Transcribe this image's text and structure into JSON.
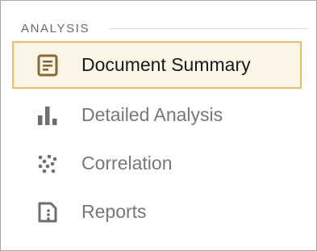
{
  "section": {
    "title": "ANALYSIS"
  },
  "nav": {
    "items": [
      {
        "label": "Document Summary",
        "icon": "document-summary-icon",
        "active": true
      },
      {
        "label": "Detailed Analysis",
        "icon": "bar-chart-icon",
        "active": false
      },
      {
        "label": "Correlation",
        "icon": "scatter-dots-icon",
        "active": false
      },
      {
        "label": "Reports",
        "icon": "report-page-icon",
        "active": false
      }
    ]
  },
  "colors": {
    "active_border": "#e8c062",
    "active_background": "#fbf5e8",
    "active_icon": "#8a6a34",
    "inactive_icon": "#6e6e6e",
    "inactive_text": "#777777",
    "active_text": "#1a1a1a"
  }
}
